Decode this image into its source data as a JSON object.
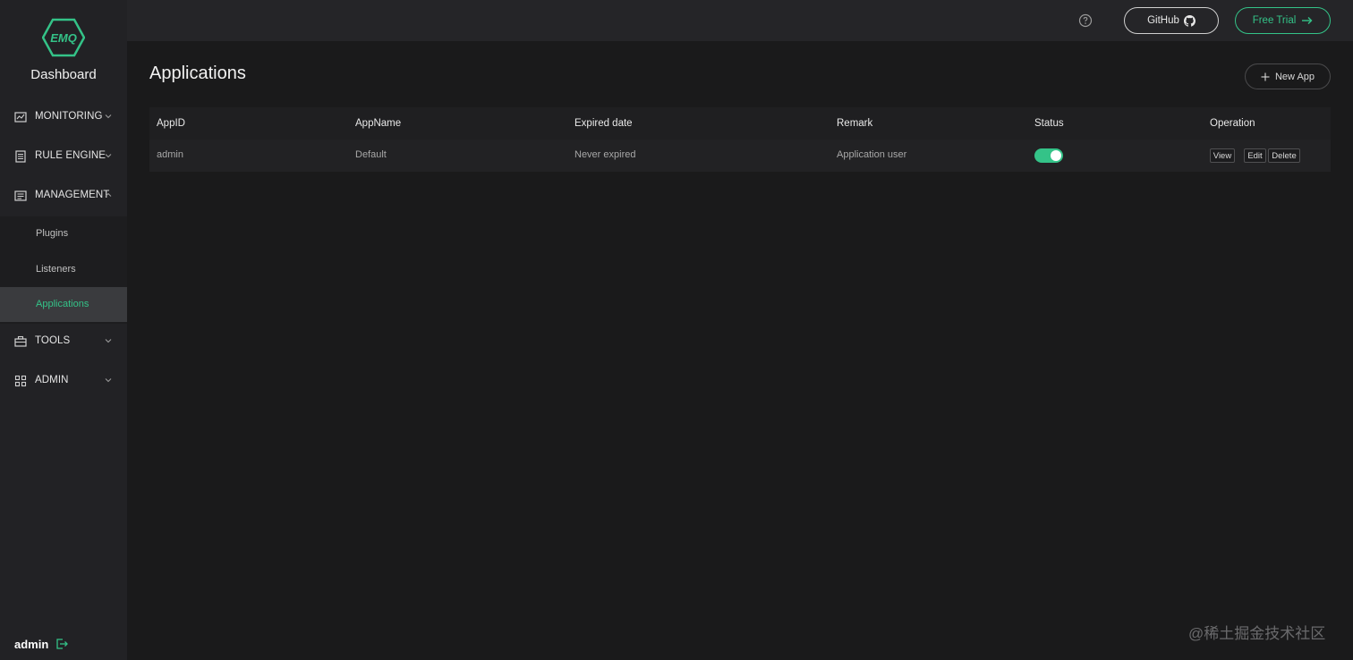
{
  "brand": {
    "logo_text": "EMQ",
    "title": "Dashboard",
    "accent": "#34c388"
  },
  "sidebar": {
    "items": [
      {
        "label": "MONITORING",
        "icon": "chart-icon"
      },
      {
        "label": "RULE ENGINE",
        "icon": "document-icon"
      },
      {
        "label": "MANAGEMENT",
        "icon": "list-icon"
      },
      {
        "label": "TOOLS",
        "icon": "toolbox-icon"
      },
      {
        "label": "ADMIN",
        "icon": "grid-icon"
      }
    ],
    "management_sub": [
      {
        "label": "Plugins"
      },
      {
        "label": "Listeners"
      },
      {
        "label": "Applications"
      }
    ],
    "user": "admin"
  },
  "header": {
    "github_label": "GitHub",
    "trial_label": "Free Trial"
  },
  "main": {
    "title": "Applications",
    "new_app_label": "New App",
    "columns": [
      "AppID",
      "AppName",
      "Expired date",
      "Remark",
      "Status",
      "Operation"
    ],
    "rows": [
      {
        "app_id": "admin",
        "app_name": "Default",
        "expired": "Never expired",
        "remark": "Application user",
        "status_enabled": true,
        "ops": [
          "View",
          "Edit",
          "Delete"
        ]
      }
    ]
  },
  "watermark": "@稀土掘金技术社区"
}
